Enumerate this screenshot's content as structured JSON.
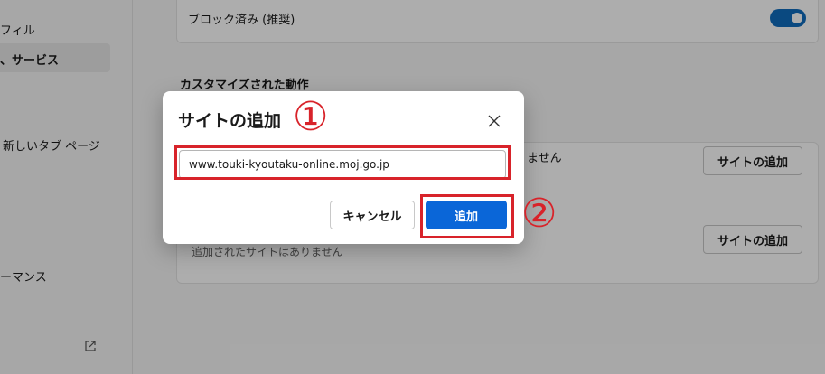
{
  "sidebar": {
    "items": [
      {
        "label": "フィル"
      },
      {
        "label": "、サービス"
      },
      {
        "label": "新しいタブ ページ"
      },
      {
        "label": "ーマンス"
      }
    ]
  },
  "main": {
    "blocked_row": {
      "label": "ブロック済み (推奨)",
      "toggle_on": true
    },
    "custom_section_title": "カスタマイズされた動作",
    "row1_partial_text": "ません",
    "add_site_button_1": "サイトの追加",
    "add_site_button_2": "サイトの追加",
    "no_sites_text": "追加されたサイトはありません"
  },
  "dialog": {
    "title": "サイトの追加",
    "input_value": "www.touki-kyoutaku-online.moj.go.jp",
    "cancel_label": "キャンセル",
    "add_label": "追加"
  },
  "annotations": {
    "step1": "①",
    "step2": "②"
  },
  "colors": {
    "accent": "#0f6cbd",
    "primary_button": "#0a66d8",
    "annotation_red": "#d8232a"
  }
}
